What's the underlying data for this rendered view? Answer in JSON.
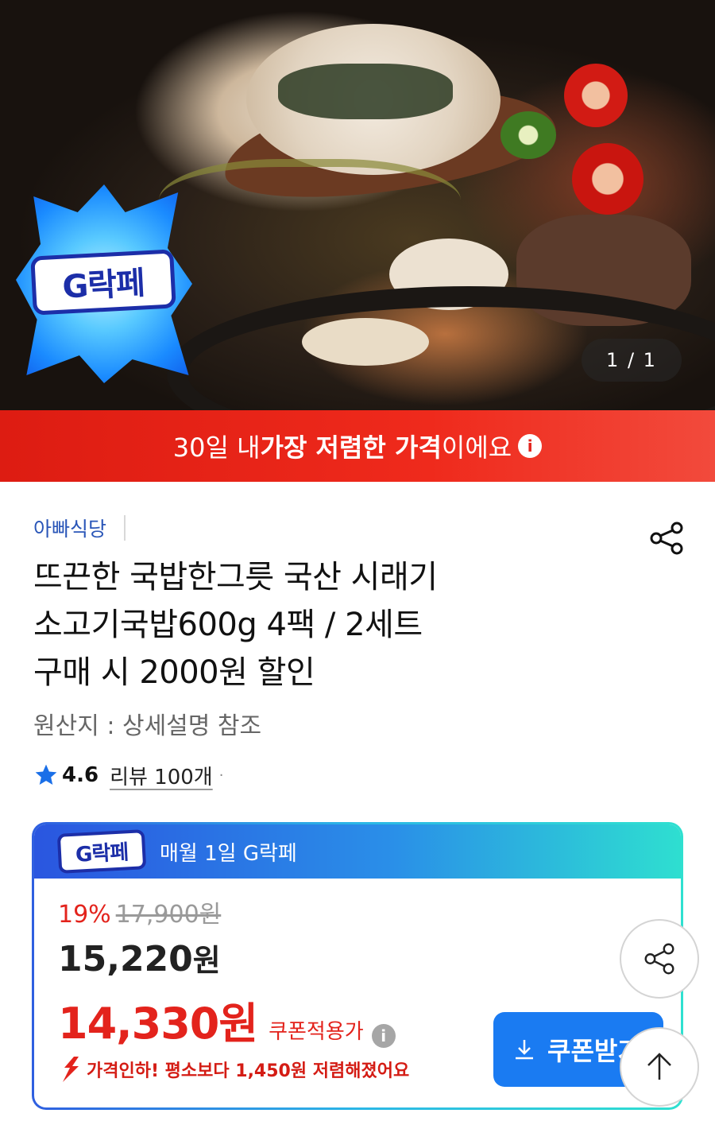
{
  "hero": {
    "image_counter": "1 / 1",
    "badge_text": "G락페",
    "icon": "g-lakpe-badge-icon"
  },
  "banner": {
    "prefix": "30일 내 ",
    "emphasis": "가장 저렴한 가격",
    "suffix": "이에요",
    "info_icon": "i",
    "color": "#e3231c"
  },
  "product": {
    "store_name": "아빠식당",
    "title_lines": [
      "뜨끈한 국밥한그릇 국산 시래기",
      "소고기국밥600g 4팩 / 2세트",
      "구매 시 2000원 할인"
    ],
    "origin": "원산지 : 상세설명 참조",
    "rating": "4.6",
    "reviews": "리뷰 100개",
    "dot": "·"
  },
  "deal": {
    "logo_text": "G락페",
    "header_text": "매월 1일 G락페",
    "discount_pct": "19%",
    "original_price": "17,900원",
    "sale_price_number": "15,220",
    "sale_price_unit": "원",
    "coupon_price": "14,330원",
    "coupon_label": "쿠폰적용가",
    "coupon_info_icon": "i",
    "coupon_button": "쿠폰받기",
    "price_drop_text": "가격인하! 평소보다 1,450원 저렴해졌어요",
    "accent_blue": "#1a7bf2"
  },
  "fabs": {
    "share_icon": "share-icon",
    "top_icon": "arrow-up-icon"
  }
}
